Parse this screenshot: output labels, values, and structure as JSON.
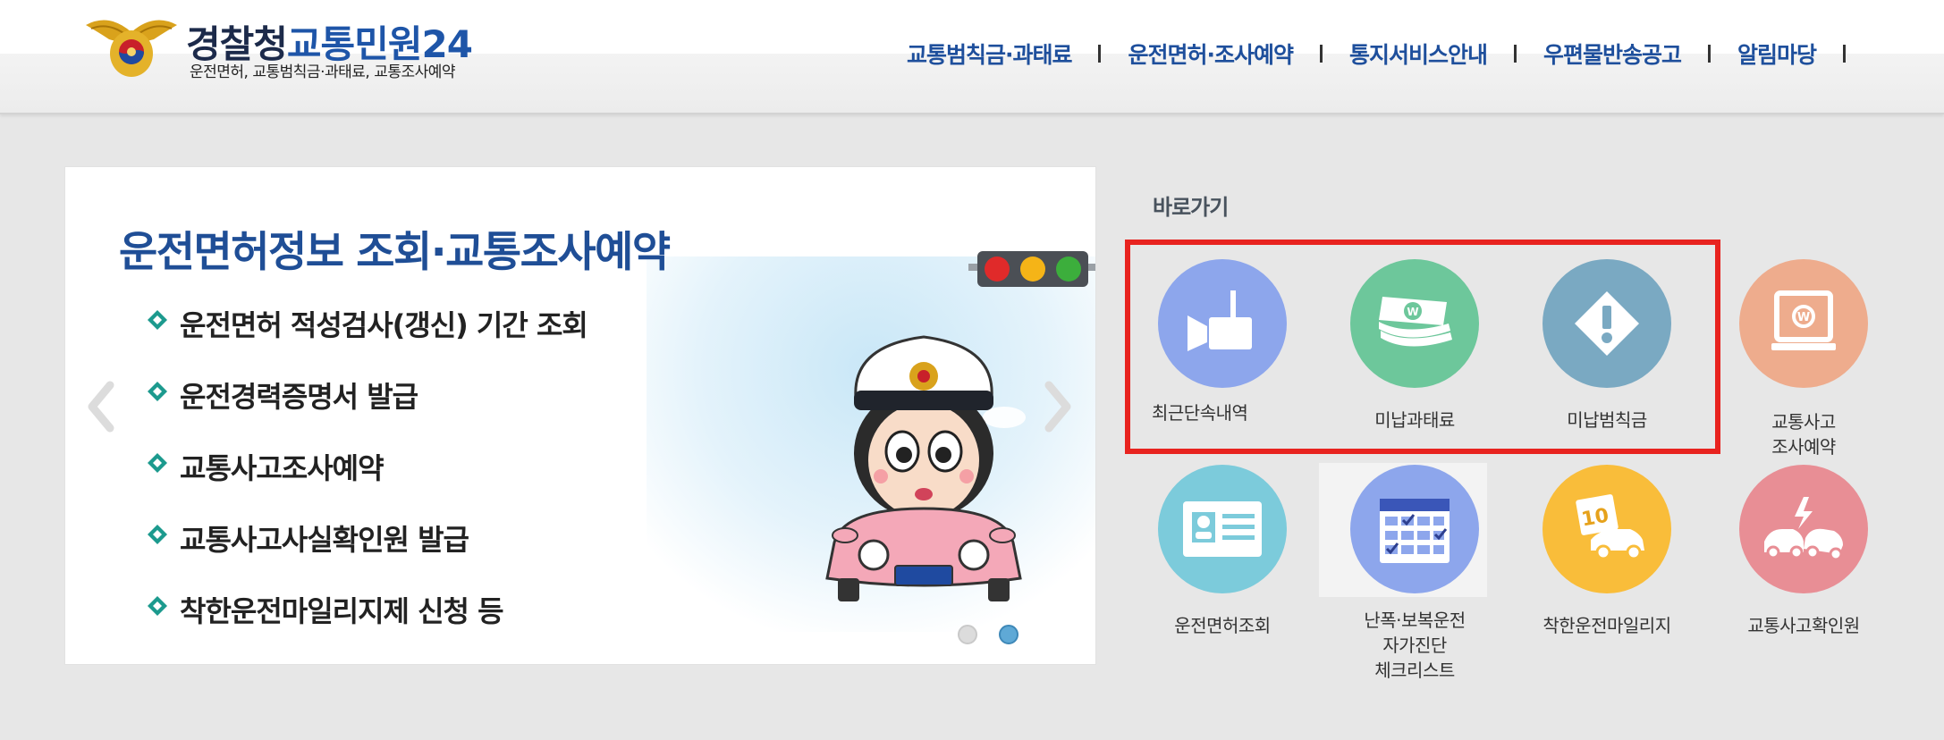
{
  "header": {
    "logo": {
      "main": "경찰청",
      "service": "교통민원24",
      "subtitle": "운전면허, 교통범칙금·과태료, 교통조사예약"
    },
    "nav": [
      {
        "label": "교통범칙금·과태료"
      },
      {
        "label": "운전면허·조사예약"
      },
      {
        "label": "통지서비스안내"
      },
      {
        "label": "우편물반송공고"
      },
      {
        "label": "알림마당"
      }
    ]
  },
  "banner": {
    "title": "운전면허정보 조회·교통조사예약",
    "items": [
      "운전면허 적성검사(갱신) 기간 조회",
      "운전경력증명서 발급",
      "교통사고조사예약",
      "교통사고사실확인원 발급",
      "착한운전마일리지제 신청 등"
    ],
    "pagination": {
      "total": 2,
      "active": 2
    }
  },
  "quick_links": {
    "title": "바로가기",
    "items": [
      {
        "label": "최근단속내역",
        "icon": "camera-icon",
        "color": "#8da6ec"
      },
      {
        "label": "미납과태료",
        "icon": "money-icon",
        "color": "#6dc79b"
      },
      {
        "label": "미납범칙금",
        "icon": "warning-icon",
        "color": "#7aa9c2"
      },
      {
        "label": "교통사고\n조사예약",
        "icon": "kiosk-icon",
        "color": "#eeac8d"
      },
      {
        "label": "운전면허조회",
        "icon": "license-icon",
        "color": "#7ccbdb"
      },
      {
        "label": "난폭·보복운전\n자가진단\n체크리스트",
        "icon": "calendar-icon",
        "color": "#8da6ec"
      },
      {
        "label": "착한운전마일리지",
        "icon": "mileage-icon",
        "color": "#f9bd3a"
      },
      {
        "label": "교통사고확인원",
        "icon": "accident-icon",
        "color": "#e88e95"
      }
    ]
  },
  "colors": {
    "brand_blue": "#1e4f9c",
    "highlight": "#e8231f",
    "background": "#e7e7e7"
  }
}
